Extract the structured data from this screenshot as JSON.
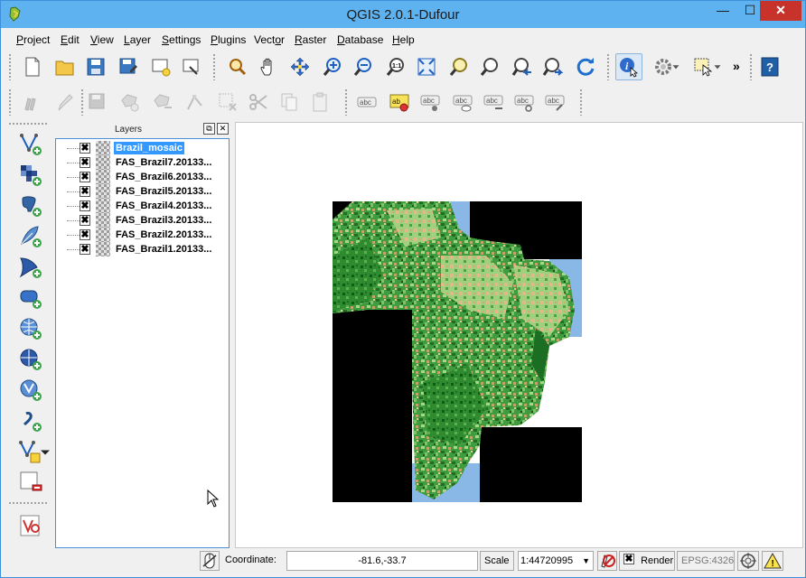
{
  "window": {
    "title": "QGIS 2.0.1-Dufour",
    "minimize": "—",
    "maximize": "☐",
    "close": "✕"
  },
  "menu": [
    {
      "pre": "",
      "key": "P",
      "post": "roject"
    },
    {
      "pre": "",
      "key": "E",
      "post": "dit"
    },
    {
      "pre": "",
      "key": "V",
      "post": "iew"
    },
    {
      "pre": "",
      "key": "L",
      "post": "ayer"
    },
    {
      "pre": "",
      "key": "S",
      "post": "ettings"
    },
    {
      "pre": "",
      "key": "P",
      "post": "lugins"
    },
    {
      "pre": "Vect",
      "key": "o",
      "post": "r"
    },
    {
      "pre": "",
      "key": "R",
      "post": "aster"
    },
    {
      "pre": "",
      "key": "D",
      "post": "atabase"
    },
    {
      "pre": "",
      "key": "H",
      "post": "elp"
    }
  ],
  "toolbar_more": "»",
  "layers": {
    "title": "Layers",
    "float_btn": "⧉",
    "close_btn": "✕",
    "check_mark": "✖",
    "items": [
      {
        "name": "Brazil_mosaic",
        "selected": true
      },
      {
        "name": "FAS_Brazil7.20133..."
      },
      {
        "name": "FAS_Brazil6.20133..."
      },
      {
        "name": "FAS_Brazil5.20133..."
      },
      {
        "name": "FAS_Brazil4.20133..."
      },
      {
        "name": "FAS_Brazil3.20133..."
      },
      {
        "name": "FAS_Brazil2.20133..."
      },
      {
        "name": "FAS_Brazil1.20133..."
      }
    ]
  },
  "status": {
    "coordinate_label": "Coordinate:",
    "coordinate_value": "-81.6,-33.7",
    "scale_label": "Scale",
    "scale_value": "1:44720995",
    "dropdown_arrow": "▼",
    "render_check": "✖",
    "render_label": "Render",
    "crs": "EPSG:4326",
    "warning_mark": "!"
  },
  "colors": {
    "titlebar": "#5fb2f0",
    "selection": "#3399ff",
    "close": "#c7332a"
  }
}
